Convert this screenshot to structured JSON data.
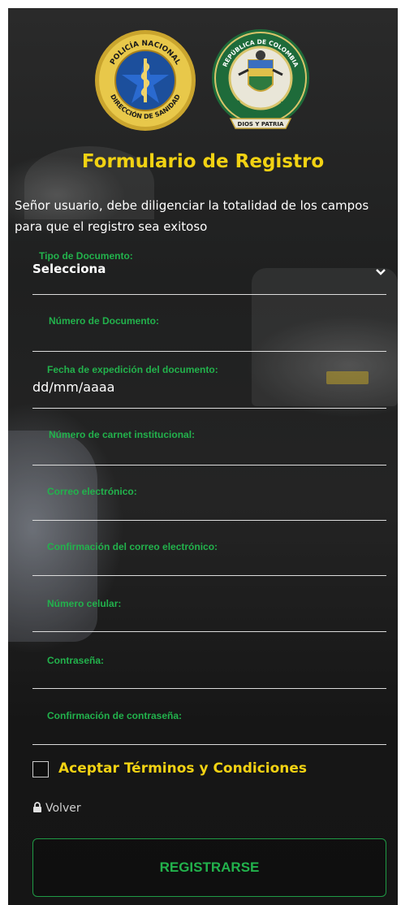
{
  "header": {
    "logo_left_text_top": "POLICÍA NACIONAL",
    "logo_left_text_bottom": "DIRECCIÓN DE SANIDAD",
    "logo_right_text_top": "REPÚBLICA DE COLOMBIA",
    "logo_right_text_middle": "POLICÍA NACIONAL",
    "logo_right_text_bottom": "DIOS Y PATRIA",
    "title": "Formulario de Registro",
    "intro": "Señor usuario, debe diligenciar la totalidad de los campos para que el registro sea exitoso"
  },
  "form": {
    "document_type": {
      "label": "Tipo de Documento:",
      "value": "Selecciona"
    },
    "document_number": {
      "label": "Número de Documento:",
      "value": ""
    },
    "issue_date": {
      "label": "Fecha de expedición del documento:",
      "value": "dd/mm/aaaa"
    },
    "carnet_number": {
      "label": "Número de carnet institucional:",
      "value": ""
    },
    "email": {
      "label": "Correo electrónico:",
      "value": ""
    },
    "email_confirm": {
      "label": "Confirmación del correo electrónico:",
      "value": ""
    },
    "phone": {
      "label": "Número celular:",
      "value": ""
    },
    "password": {
      "label": "Contraseña:",
      "value": ""
    },
    "password_confirm": {
      "label": "Confirmación de contraseña:",
      "value": ""
    }
  },
  "terms": {
    "label": "Aceptar Términos y Condiciones",
    "checked": false
  },
  "back": {
    "label": "Volver",
    "icon": "lock-icon"
  },
  "submit": {
    "label": "REGISTRARSE"
  },
  "colors": {
    "accent_yellow": "#f2d213",
    "accent_green": "#22b24c"
  }
}
